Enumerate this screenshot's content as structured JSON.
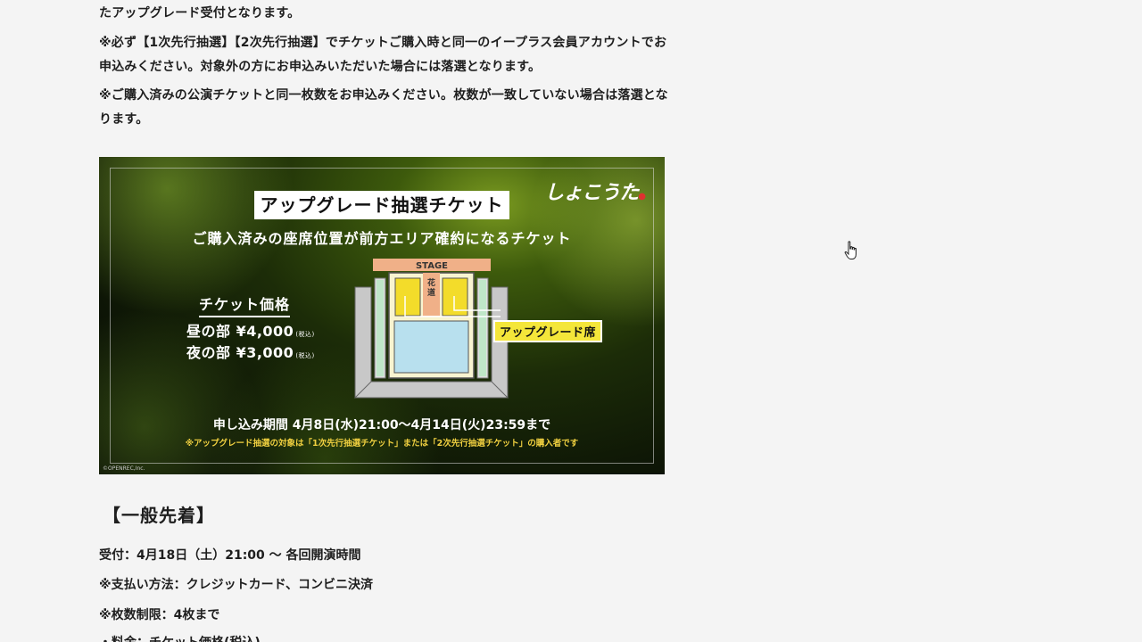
{
  "content": {
    "paragraphs": [
      "たアップグレード受付となります。",
      "※必ず【1次先行抽選】【2次先行抽選】でチケットご購入時と同一のイープラス会員アカウントでお申込みください。対象外の方にお申込みいただいた場合には落選となります。",
      "※ご購入済みの公演チケットと同一枚数をお申込みください。枚数が一致していない場合は落選となります。"
    ],
    "banner": {
      "title": "アップグレード抽選チケット",
      "logo": "しょこうた",
      "subtitle": "ご購入済みの座席位置が前方エリア確約になるチケット",
      "stage_label": "STAGE",
      "hanamichi_label": "花道",
      "upgrade_label": "アップグレード席",
      "price_heading": "チケット価格",
      "prices": [
        {
          "label": "昼の部 ¥4,000",
          "tax": "(税込)"
        },
        {
          "label": "夜の部 ¥3,000",
          "tax": "(税込)"
        }
      ],
      "period": "申し込み期間 4月8日(水)21:00〜4月14日(火)23:59まで",
      "note": "※アップグレード抽選の対象は「1次先行抽選チケット」または「2次先行抽選チケット」の購入者です",
      "copyright": "©OPENREC,Inc.",
      "colors": {
        "highlight": "#f4e63a",
        "stage": "#f0b088",
        "floor": "#b8e0ee",
        "seats": "#f3dc2a"
      }
    },
    "section_heading": "【一般先着】",
    "info_lines": [
      "受付：4月18日（土）21:00 〜 各回開演時間",
      "※支払い方法：クレジットカード、コンビニ決済",
      "※枚数制限：4枚まで",
      "・料金：チケット価格(税込)"
    ]
  }
}
